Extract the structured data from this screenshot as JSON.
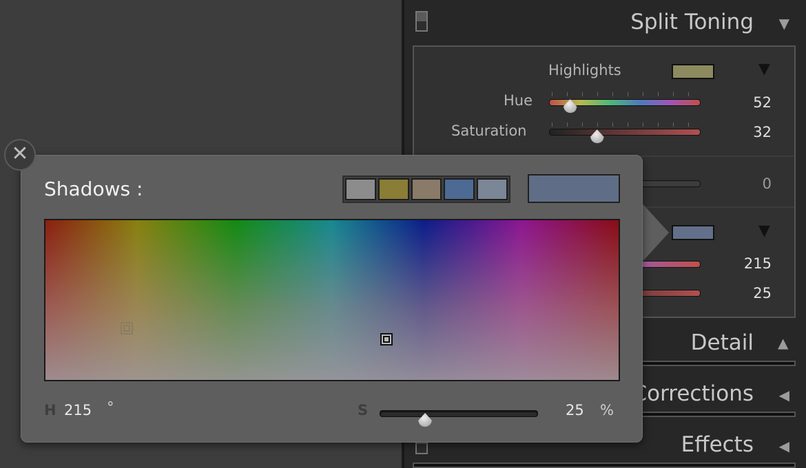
{
  "panel": {
    "split_toning": {
      "title": "Split Toning",
      "highlights": {
        "label": "Highlights",
        "color": "#8e8a60",
        "hue": {
          "label": "Hue",
          "value": "52",
          "fraction": 0.14
        },
        "saturation": {
          "label": "Saturation",
          "value": "32",
          "fraction": 0.32
        }
      },
      "balance": {
        "value": "0"
      },
      "shadows": {
        "color": "#63708a",
        "hue": {
          "value": "215"
        },
        "saturation": {
          "value": "25"
        }
      }
    },
    "detail": {
      "title": "Detail"
    },
    "lens_corrections": {
      "title": "Lens Corrections"
    },
    "effects": {
      "title": "Effects"
    }
  },
  "popup": {
    "title": "Shadows :",
    "presets": [
      "#8c8c8c",
      "#8a7d35",
      "#8a7a68",
      "#4d6a94",
      "#7b8797"
    ],
    "current_color": "#5f6e86",
    "hue_label": "H",
    "hue_value": "215",
    "hue_unit": "°",
    "sat_label": "S",
    "sat_value": "25",
    "sat_unit": "%",
    "sat_fraction": 0.29,
    "close_glyph": "✕"
  }
}
